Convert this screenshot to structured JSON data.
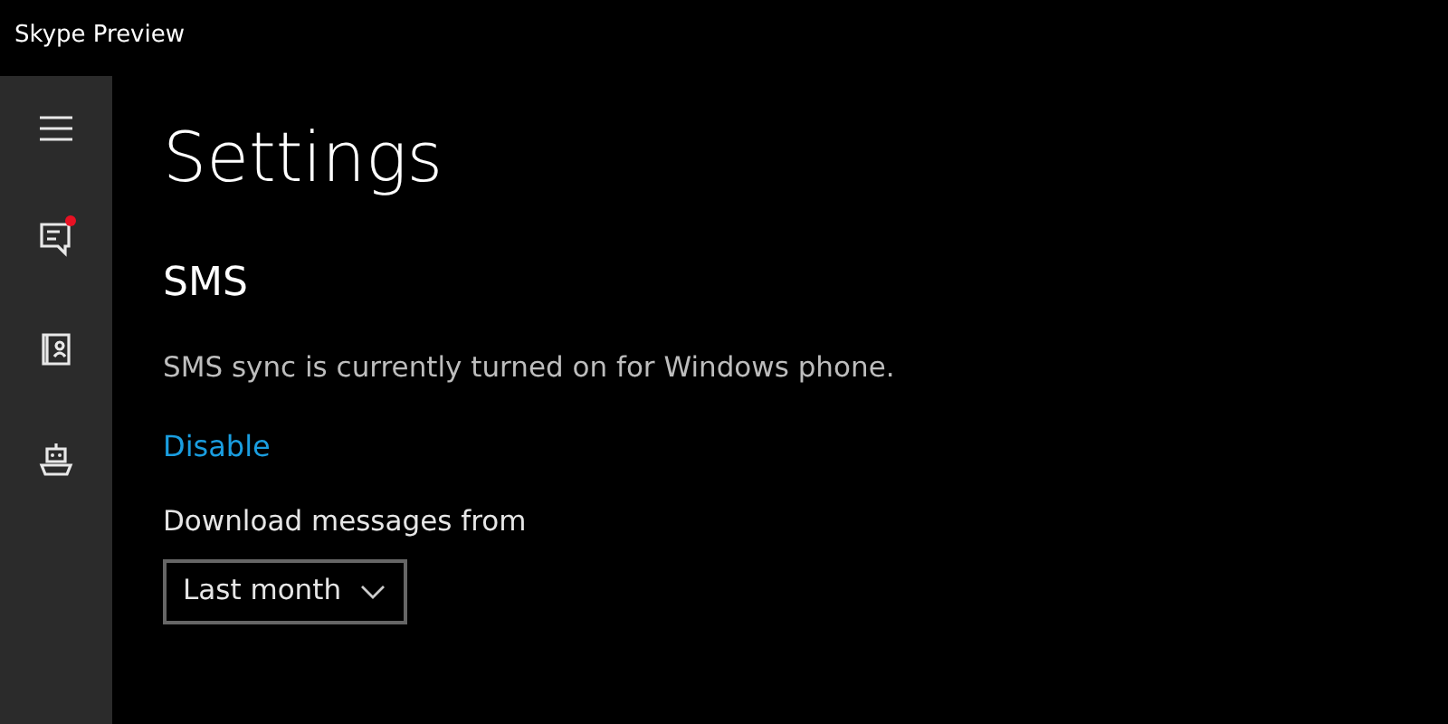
{
  "window": {
    "title": "Skype Preview"
  },
  "sidebar": {
    "items": [
      {
        "kind": "menu",
        "notification": false
      },
      {
        "kind": "chats",
        "notification": true
      },
      {
        "kind": "contacts",
        "notification": false
      },
      {
        "kind": "bots",
        "notification": false
      }
    ]
  },
  "page": {
    "title": "Settings",
    "section": "SMS",
    "status": "SMS sync is currently turned on for Windows phone.",
    "action": "Disable",
    "field": {
      "label": "Download messages from",
      "value": "Last month"
    }
  }
}
